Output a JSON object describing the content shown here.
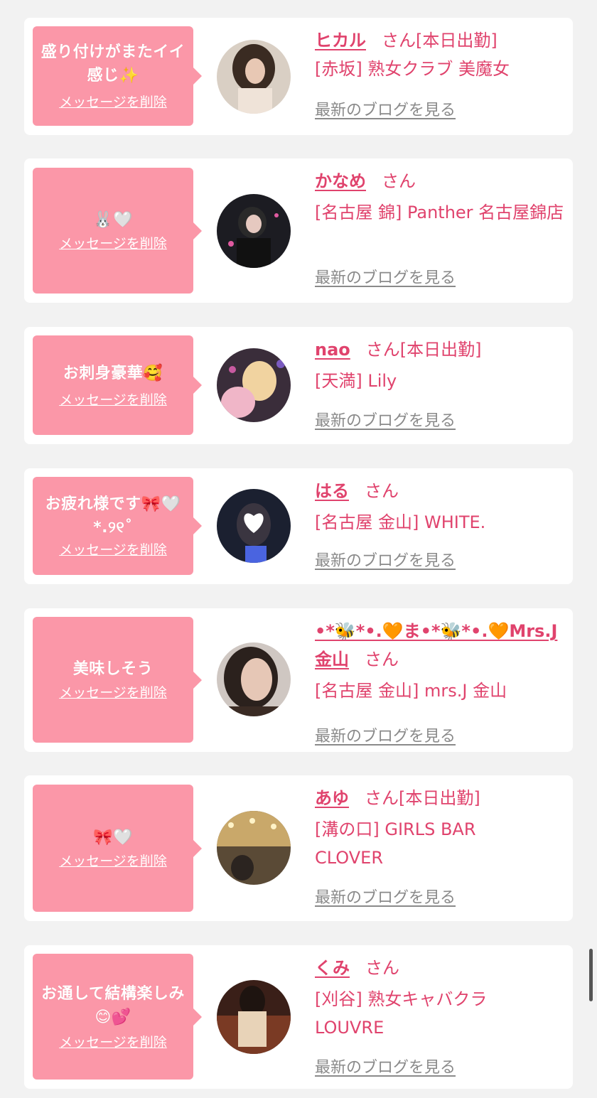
{
  "cards": [
    {
      "message": "盛り付けがまたイイ感じ✨",
      "delete_label": "メッセージを削除",
      "name": "ヒカル",
      "san": "さん",
      "status": "[本日出勤]",
      "shop": "[赤坂] 熟女クラブ 美魔女",
      "blog_label": "最新のブログを見る"
    },
    {
      "message": "🐰🤍",
      "delete_label": "メッセージを削除",
      "name": "かなめ",
      "san": "さん",
      "status": "",
      "shop": "[名古屋 錦] Panther 名古屋錦店",
      "blog_label": "最新のブログを見る"
    },
    {
      "message": "お刺身豪華🥰",
      "delete_label": "メッセージを削除",
      "name": "nao",
      "san": "さん",
      "status": "[本日出勤]",
      "shop": "[天満] Lily",
      "blog_label": "最新のブログを見る"
    },
    {
      "message": "お疲れ様です🎀🤍*.୨୧˚",
      "delete_label": "メッセージを削除",
      "name": "はる",
      "san": "さん",
      "status": "",
      "shop": "[名古屋 金山] WHITE.",
      "blog_label": "最新のブログを見る"
    },
    {
      "message": "美味しそう",
      "delete_label": "メッセージを削除",
      "name": "•*🐝*•.🧡ま•*🐝*•.🧡Mrs.J金山",
      "san": "さん",
      "status": "",
      "shop": "[名古屋 金山] mrs.J 金山",
      "blog_label": "最新のブログを見る"
    },
    {
      "message": "🎀🤍",
      "delete_label": "メッセージを削除",
      "name": "あゆ",
      "san": "さん",
      "status": "[本日出勤]",
      "shop": "[溝の口] GIRLS BAR CLOVER",
      "blog_label": "最新のブログを見る"
    },
    {
      "message": "お通して結構楽しみ😊💕",
      "delete_label": "メッセージを削除",
      "name": "くみ",
      "san": "さん",
      "status": "",
      "shop": "[刈谷] 熟女キャバクラ LOUVRE",
      "blog_label": "最新のブログを見る"
    }
  ],
  "colors": {
    "accent": "#e0436d",
    "bubble": "#fb97a8",
    "link_gray": "#8a8a8a",
    "background": "#f2f2f2"
  }
}
